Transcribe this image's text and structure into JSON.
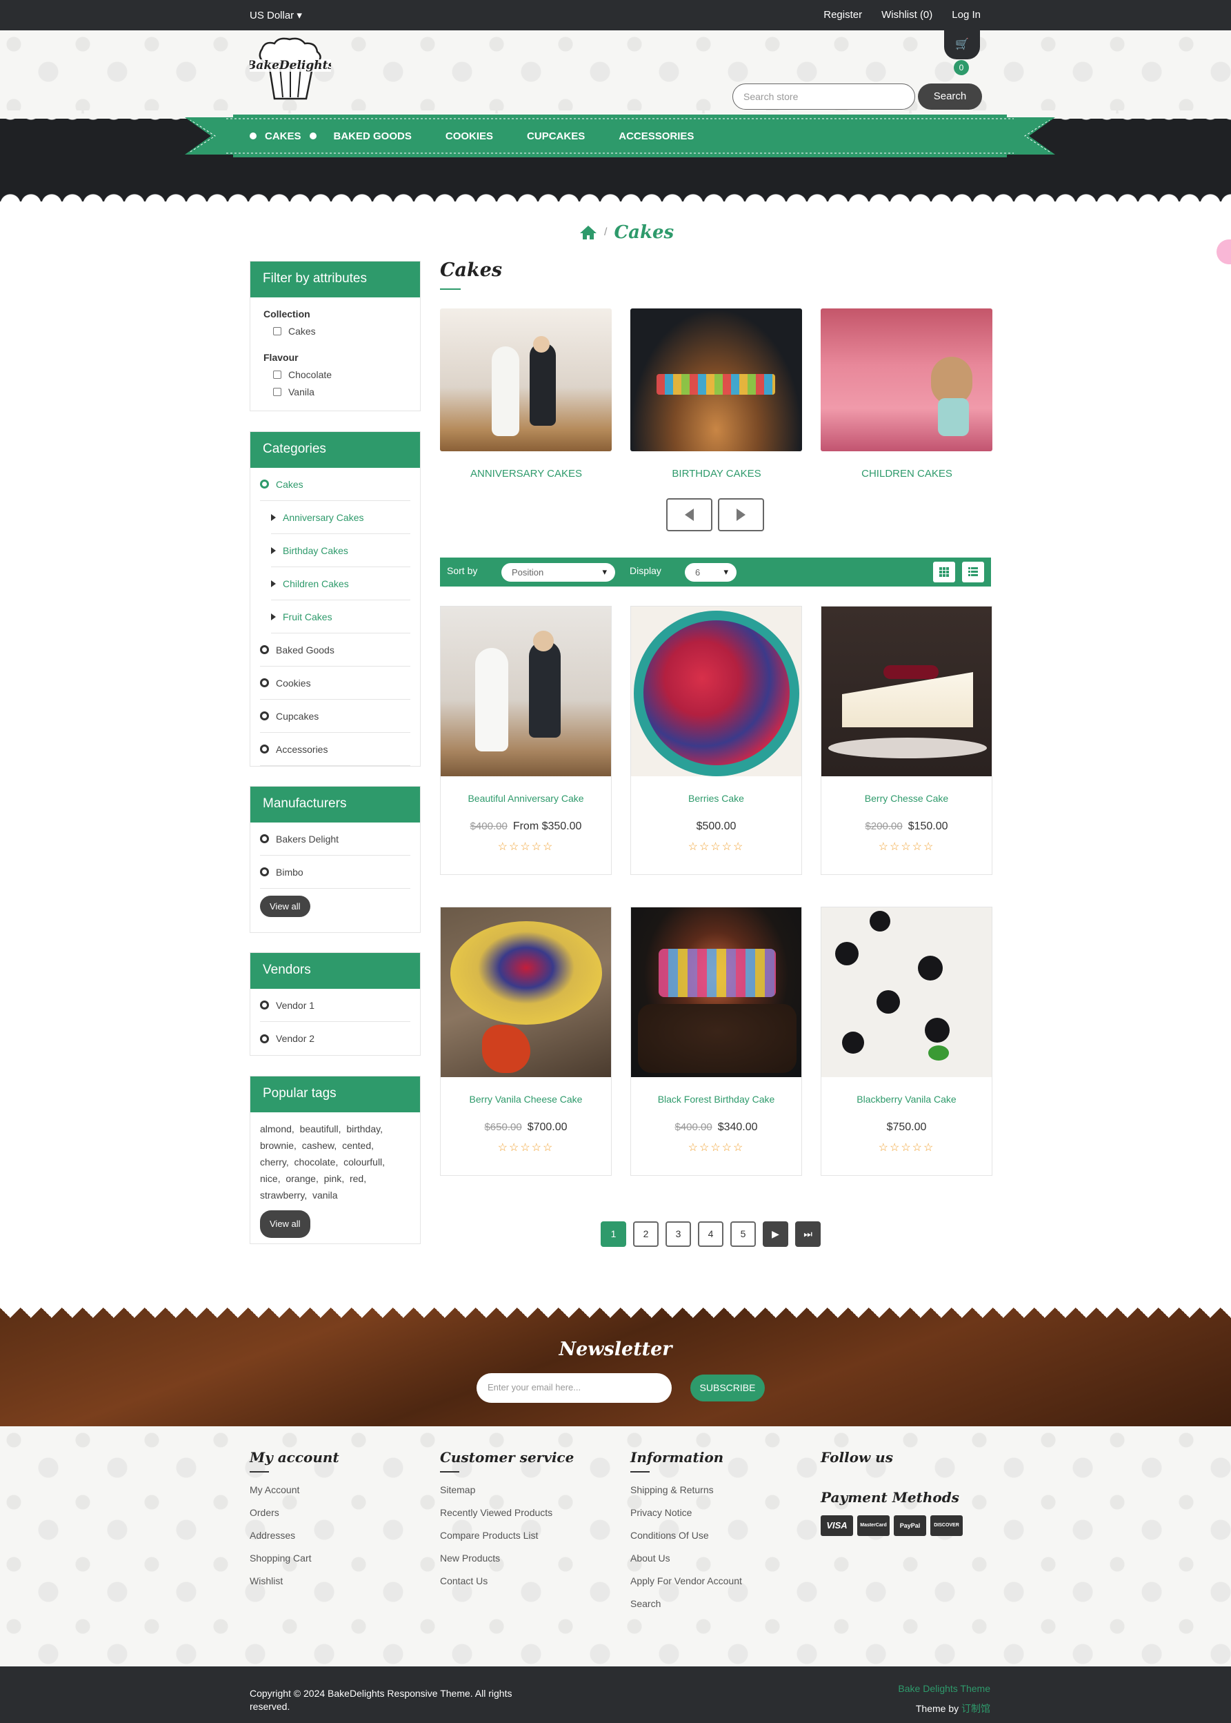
{
  "topbar": {
    "currency": "US Dollar",
    "register": "Register",
    "wishlist": "Wishlist (0)",
    "login": "Log In"
  },
  "header": {
    "logo_text": "BakeDelights",
    "cart_count": "0",
    "search_placeholder": "Search store",
    "search_button": "Search"
  },
  "nav": [
    "CAKES",
    "BAKED GOODS",
    "COOKIES",
    "CUPCAKES",
    "ACCESSORIES"
  ],
  "breadcrumb": {
    "current": "Cakes",
    "separator": "/"
  },
  "sidebar": {
    "filter": {
      "title": "Filter by attributes",
      "groups": [
        {
          "label": "Collection",
          "options": [
            "Cakes"
          ]
        },
        {
          "label": "Flavour",
          "options": [
            "Chocolate",
            "Vanila"
          ]
        }
      ]
    },
    "categories": {
      "title": "Categories",
      "items": [
        {
          "label": "Cakes",
          "active": true
        },
        {
          "label": "Anniversary Cakes",
          "sub": true
        },
        {
          "label": "Birthday Cakes",
          "sub": true
        },
        {
          "label": "Children Cakes",
          "sub": true
        },
        {
          "label": "Fruit Cakes",
          "sub": true
        },
        {
          "label": "Baked Goods"
        },
        {
          "label": "Cookies"
        },
        {
          "label": "Cupcakes"
        },
        {
          "label": "Accessories"
        }
      ]
    },
    "manufacturers": {
      "title": "Manufacturers",
      "items": [
        "Bakers Delight",
        "Bimbo"
      ],
      "view_all": "View all"
    },
    "vendors": {
      "title": "Vendors",
      "items": [
        "Vendor 1",
        "Vendor 2"
      ]
    },
    "tags": {
      "title": "Popular tags",
      "items": [
        "almond",
        "beautifull",
        "birthday",
        "brownie",
        "cashew",
        "cented",
        "cherry",
        "chocolate",
        "colourfull",
        "nice",
        "orange",
        "pink",
        "red",
        "strawberry",
        "vanila"
      ],
      "view_all": "View all"
    }
  },
  "main": {
    "title": "Cakes",
    "subcategories": [
      "ANNIVERSARY CAKES",
      "BIRTHDAY CAKES",
      "CHILDREN CAKES"
    ],
    "toolbar": {
      "sort_label": "Sort by",
      "sort_value": "Position",
      "display_label": "Display",
      "display_value": "6"
    },
    "products": [
      {
        "name": "Beautiful Anniversary Cake",
        "old_price": "$400.00",
        "price": "From $350.00"
      },
      {
        "name": "Berries Cake",
        "old_price": "",
        "price": "$500.00"
      },
      {
        "name": "Berry Chesse Cake",
        "old_price": "$200.00",
        "price": "$150.00"
      },
      {
        "name": "Berry Vanila Cheese Cake",
        "old_price": "$650.00",
        "price": "$700.00"
      },
      {
        "name": "Black Forest Birthday Cake",
        "old_price": "$400.00",
        "price": "$340.00"
      },
      {
        "name": "Blackberry Vanila Cake",
        "old_price": "",
        "price": "$750.00"
      }
    ],
    "stars": "☆☆☆☆☆",
    "pages": [
      "1",
      "2",
      "3",
      "4",
      "5"
    ],
    "pager_next": "▶",
    "pager_last": "⏭"
  },
  "newsletter": {
    "title": "Newsletter",
    "placeholder": "Enter your email here...",
    "button": "SUBSCRIBE"
  },
  "footer": {
    "my_account": {
      "title": "My account",
      "links": [
        "My Account",
        "Orders",
        "Addresses",
        "Shopping Cart",
        "Wishlist"
      ]
    },
    "customer_service": {
      "title": "Customer service",
      "links": [
        "Sitemap",
        "Recently Viewed Products",
        "Compare Products List",
        "New Products",
        "Contact Us"
      ]
    },
    "information": {
      "title": "Information",
      "links": [
        "Shipping & Returns",
        "Privacy Notice",
        "Conditions Of Use",
        "About Us",
        "Apply For Vendor Account",
        "Search"
      ]
    },
    "follow_us": "Follow us",
    "payment_methods": "Payment Methods",
    "cards": [
      "VISA",
      "MasterCard",
      "PayPal",
      "DISCOVER"
    ]
  },
  "bottombar": {
    "copyright": "Copyright © 2024 BakeDelights Responsive Theme. All rights reserved.",
    "theme_name": "Bake Delights Theme",
    "theme_by": "Theme by",
    "theme_author": "订制馆"
  },
  "colors": {
    "accent": "#2e9a6b",
    "dark": "#2b2d30",
    "price_old": "#999999",
    "stars": "#f0a030"
  }
}
